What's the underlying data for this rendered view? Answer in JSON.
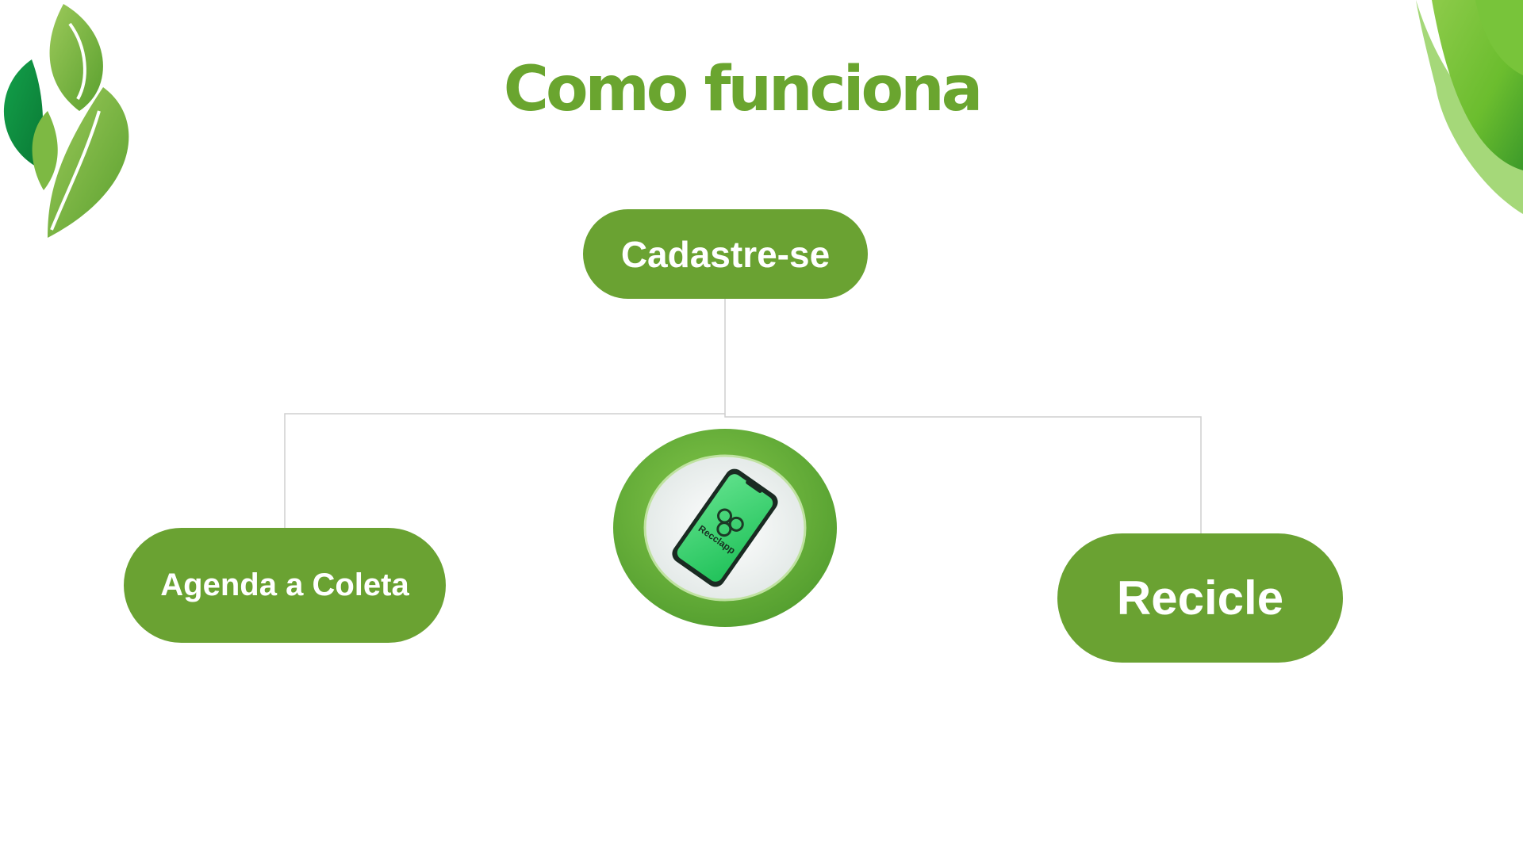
{
  "slide": {
    "title": "Como funciona"
  },
  "diagram": {
    "nodes": [
      {
        "id": "cadastre",
        "label": "Cadastre-se"
      },
      {
        "id": "agenda",
        "label": "Agenda a Coleta"
      },
      {
        "id": "recicle",
        "label": "Recicle"
      }
    ],
    "hub_image": {
      "description": "smartphone-with-recycle-app-icon",
      "app_text": "Recclapp"
    }
  },
  "colors": {
    "title": "#6aa52f",
    "pill": "#6aa232",
    "pill_text": "#ffffff",
    "connector": "#cfcfcf",
    "hub_ring": "#5ea331",
    "phone_screen": "#2fd06a"
  }
}
